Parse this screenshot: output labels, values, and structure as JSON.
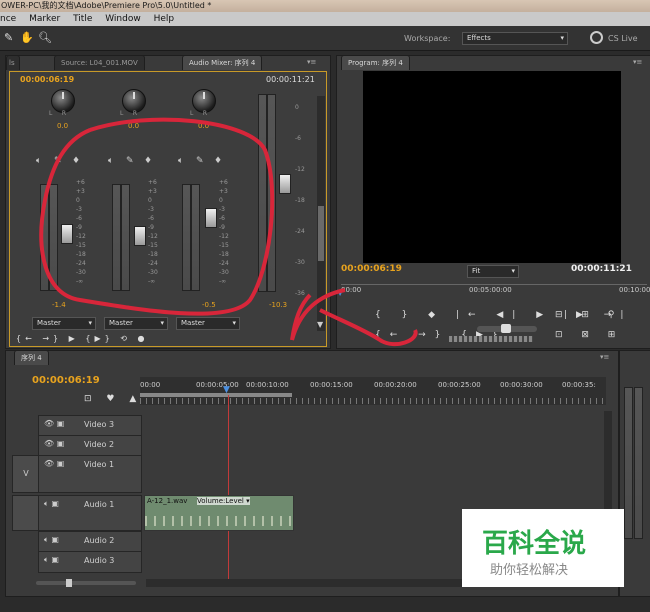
{
  "titlebar": {
    "text": "OWER-PC\\我的文档\\Adobe\\Premiere Pro\\5.0\\Untitled *"
  },
  "menu": [
    "nce",
    "Marker",
    "Title",
    "Window",
    "Help"
  ],
  "workspace": {
    "label": "Workspace:",
    "value": "Effects",
    "cslive": "CS Live"
  },
  "source_tab": "Source: L04_001.MOV",
  "mixer_tab": "Audio Mixer: 序列 4",
  "program_tab": "Program: 序列 4",
  "mixer": {
    "tc_left": "00:00:06:19",
    "tc_right": "00:00:11:21",
    "pan_values": [
      "0.0",
      "0.0",
      "0.0"
    ],
    "scale": [
      "+6",
      "+3",
      "0",
      "-3",
      "-6",
      "-9",
      "-12",
      "-15",
      "-18",
      "-24",
      "-30",
      "-∞"
    ],
    "master_scale": [
      "0",
      "-6",
      "-12",
      "-18",
      "-24",
      "-30",
      "-36"
    ],
    "vol_values": [
      "-1.4",
      "",
      "-0.5",
      "-10.3"
    ],
    "out_selects": [
      "Master",
      "Master",
      "Master"
    ]
  },
  "program": {
    "tc_current": "00:00:06:19",
    "fit": "Fit",
    "tc_duration": "00:00:11:21",
    "ruler": [
      "00:00",
      "00:05:00:00",
      "00:10:00"
    ]
  },
  "sequence": {
    "tab": "序列 4",
    "tc": "00:00:06:19",
    "ruler": [
      "00:00",
      "00:00:05:00",
      "00:00:10:00",
      "00:00:15:00",
      "00:00:20:00",
      "00:00:25:00",
      "00:00:30:00",
      "00:00:35:"
    ],
    "tracks": [
      "Video 3",
      "Video 2",
      "Video 1",
      "Audio 1",
      "Audio 2",
      "Audio 3"
    ],
    "v_label": "V",
    "clip_name": "A-12_1.wav",
    "clip_fx": "Volume:Level ▾"
  },
  "watermark": {
    "title": "百科全说",
    "subtitle": "助你轻松解决"
  },
  "colors": {
    "accent": "#e8a31e",
    "annotation": "#d8263a"
  }
}
